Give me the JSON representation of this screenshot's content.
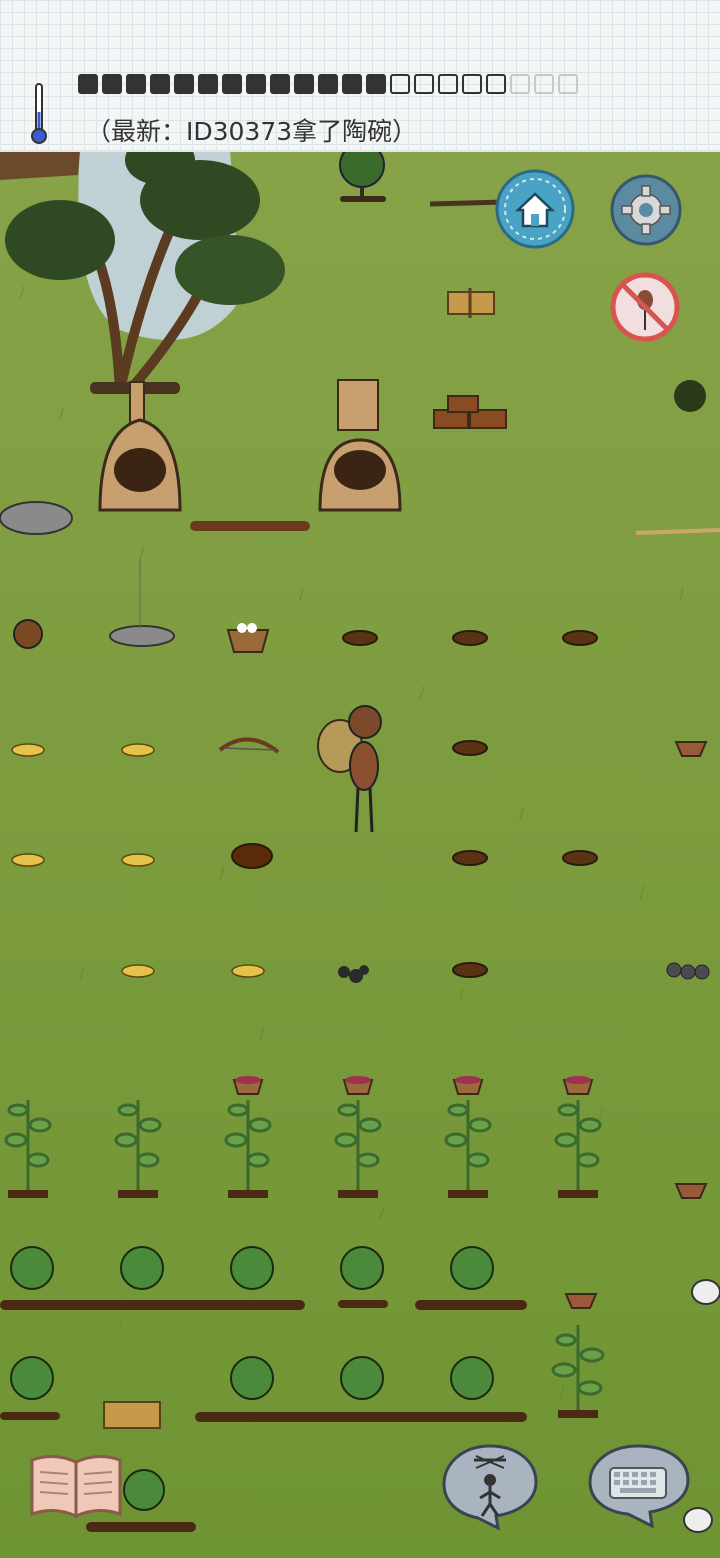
{
  "hud": {
    "latest_message": "（最新：ID30373拿了陶碗）",
    "hunger_pips": [
      1,
      1,
      1,
      1,
      1,
      1,
      1,
      1,
      1,
      1,
      1,
      1,
      1,
      0,
      0,
      0,
      0,
      0,
      2,
      2,
      2
    ]
  },
  "icons": {
    "thermometer": "thermometer-icon",
    "home": "home-icon",
    "settings": "gear-icon",
    "no_kill": "no-kill-icon",
    "book": "book-icon",
    "puppet": "puppet-icon",
    "keyboard": "keyboard-icon"
  },
  "colors": {
    "grass": "#7a9a3a",
    "paper": "#f4f6f3",
    "home_button": "#4aa3c4",
    "settings_button": "#5c8aa0",
    "no_kill_button": "#d9534f"
  }
}
